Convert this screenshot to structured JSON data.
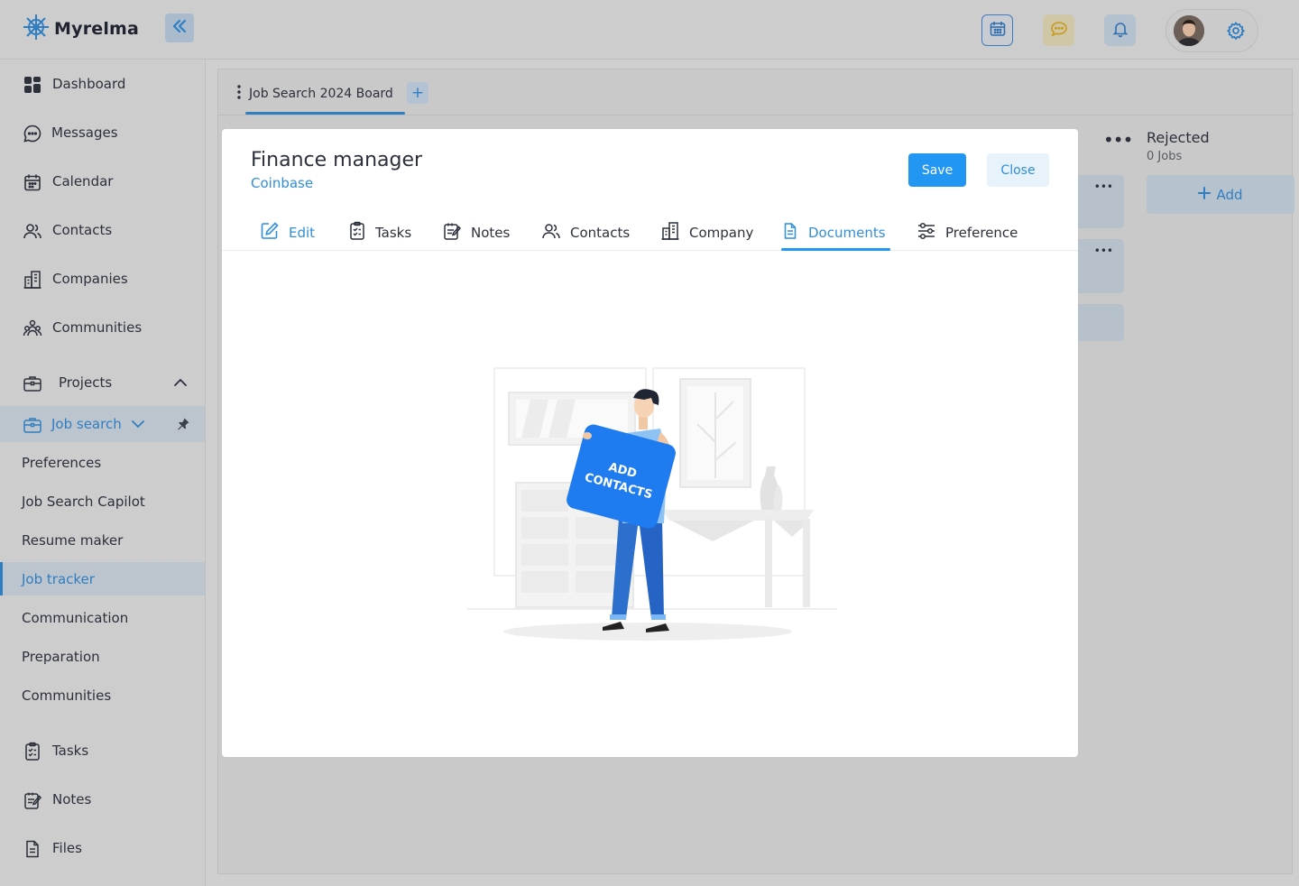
{
  "app": {
    "name": "Myrelma"
  },
  "topbar": {
    "icons": [
      "calendar-icon",
      "chat-icon",
      "bell-icon",
      "gear-icon"
    ],
    "colors": {
      "accent": "#2f7ec1",
      "primary_button": "#2196f3"
    }
  },
  "sidebar": {
    "items": [
      {
        "label": "Dashboard",
        "icon": "dashboard-icon"
      },
      {
        "label": "Messages",
        "icon": "message-icon"
      },
      {
        "label": "Calendar",
        "icon": "calendar-icon"
      },
      {
        "label": "Contacts",
        "icon": "contacts-icon"
      },
      {
        "label": "Companies",
        "icon": "building-icon"
      },
      {
        "label": "Communities",
        "icon": "community-icon"
      }
    ],
    "projects": {
      "label": "Projects"
    },
    "job_search": {
      "label": "Job search"
    },
    "sub_items": [
      {
        "label": "Preferences"
      },
      {
        "label": "Job Search Capilot"
      },
      {
        "label": "Resume maker"
      },
      {
        "label": "Job tracker"
      },
      {
        "label": "Communication"
      },
      {
        "label": "Preparation"
      },
      {
        "label": "Communities"
      }
    ],
    "bottom_items": [
      {
        "label": "Tasks",
        "icon": "tasks-icon"
      },
      {
        "label": "Notes",
        "icon": "notes-icon"
      },
      {
        "label": "Files",
        "icon": "file-icon"
      }
    ]
  },
  "board": {
    "tab_label": "Job Search 2024 Board",
    "add_label": "+",
    "rejected": {
      "title": "Rejected",
      "count": "0 Jobs",
      "add_label": "Add"
    }
  },
  "modal": {
    "title": "Finance manager",
    "company": "Coinbase",
    "save_label": "Save",
    "close_label": "Close",
    "tabs": [
      {
        "label": "Edit",
        "icon": "edit-icon"
      },
      {
        "label": "Tasks",
        "icon": "tasks-icon"
      },
      {
        "label": "Notes",
        "icon": "notes-icon"
      },
      {
        "label": "Contacts",
        "icon": "contacts-icon"
      },
      {
        "label": "Company",
        "icon": "building-icon"
      },
      {
        "label": "Documents",
        "icon": "document-icon"
      },
      {
        "label": "Preference",
        "icon": "sliders-icon"
      }
    ],
    "active_tab": "Documents",
    "illustration": {
      "sign_line1": "ADD",
      "sign_line2": "CONTACTS"
    }
  }
}
